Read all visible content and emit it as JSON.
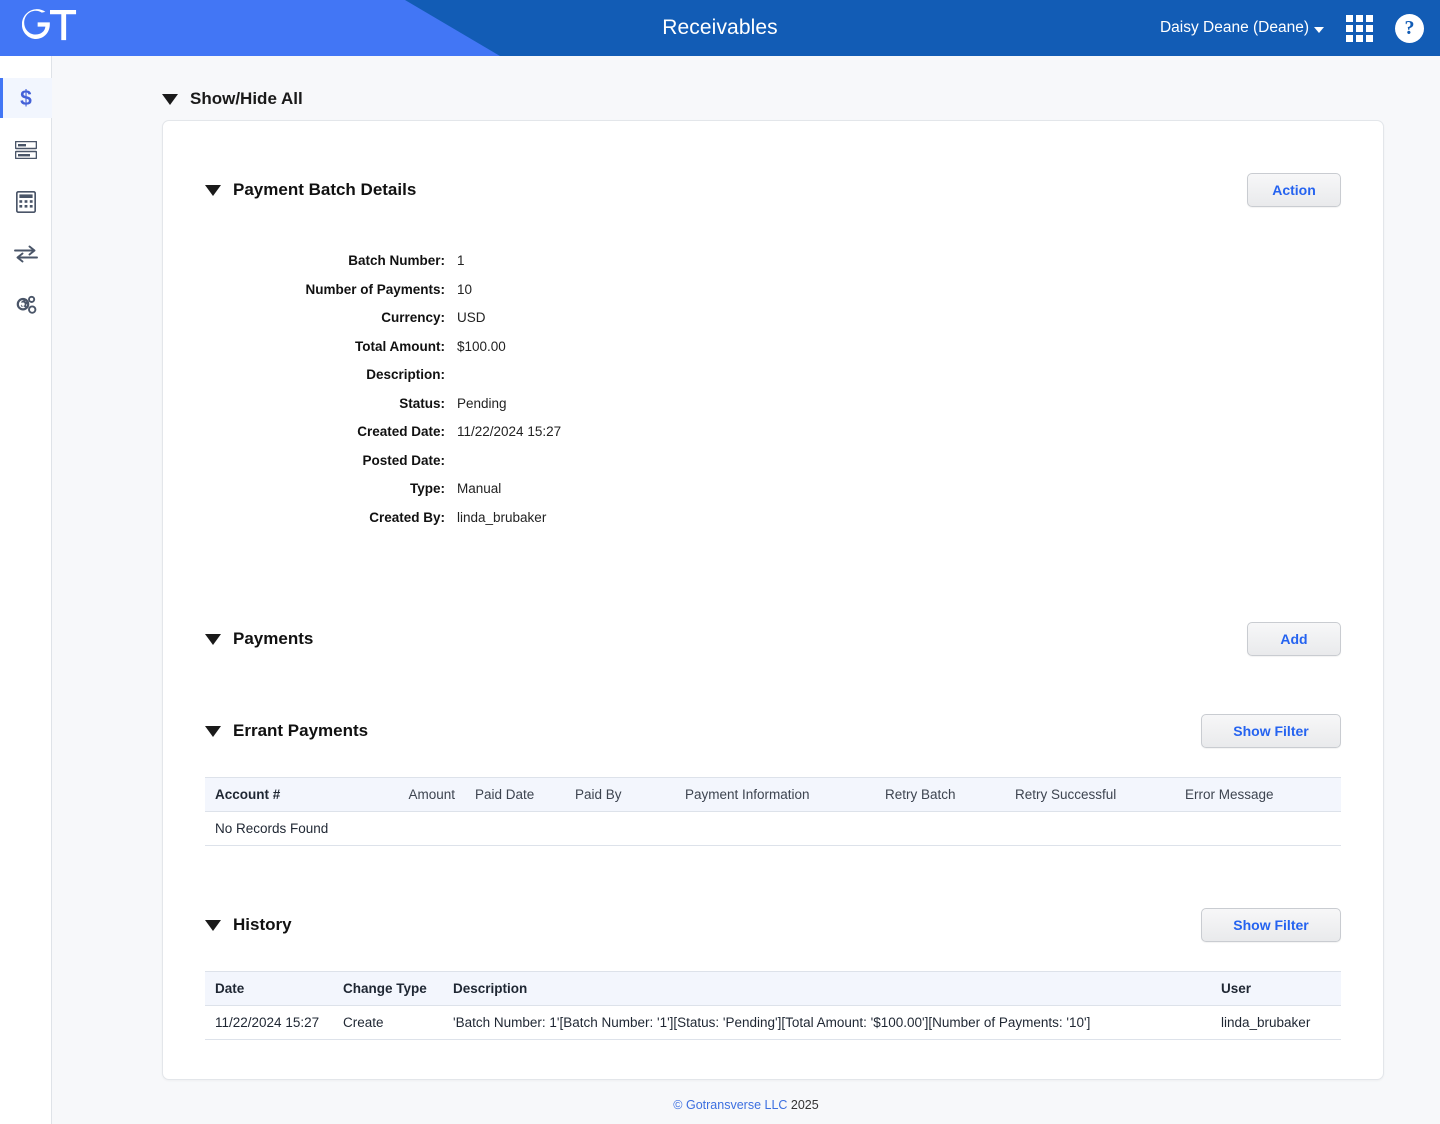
{
  "header": {
    "logo_text": "GT",
    "title": "Receivables",
    "user_menu": "Daisy Deane (Deane)",
    "apps_icon": "grid-apps-icon",
    "help_icon": "help-question-icon",
    "bg_left": "#4276f5",
    "bg_right": "#125cb5"
  },
  "sidebar": {
    "items": [
      {
        "icon": "dollar-sign-icon",
        "active": true
      },
      {
        "icon": "server-list-icon",
        "active": false
      },
      {
        "icon": "calculator-icon",
        "active": false
      },
      {
        "icon": "transfer-arrows-icon",
        "active": false
      },
      {
        "icon": "gears-settings-icon",
        "active": false
      }
    ]
  },
  "show_hide_all": {
    "label": "Show/Hide All"
  },
  "sections": {
    "payment_batch_details": {
      "title": "Payment Batch Details",
      "action_label": "Action",
      "fields": [
        {
          "label": "Batch Number:",
          "value": "1"
        },
        {
          "label": "Number of Payments:",
          "value": "10"
        },
        {
          "label": "Currency:",
          "value": "USD"
        },
        {
          "label": "Total Amount:",
          "value": "$100.00"
        },
        {
          "label": "Description:",
          "value": ""
        },
        {
          "label": "Status:",
          "value": "Pending"
        },
        {
          "label": "Created Date:",
          "value": "11/22/2024 15:27"
        },
        {
          "label": "Posted Date:",
          "value": ""
        },
        {
          "label": "Type:",
          "value": "Manual"
        },
        {
          "label": "Created By:",
          "value": "linda_brubaker"
        }
      ]
    },
    "payments": {
      "title": "Payments",
      "add_label": "Add"
    },
    "errant_payments": {
      "title": "Errant Payments",
      "show_filter_label": "Show Filter",
      "columns": [
        "Account #",
        "Amount",
        "Paid Date",
        "Paid By",
        "Payment Information",
        "Retry Batch",
        "Retry Successful",
        "Error Message"
      ],
      "empty_message": "No Records Found"
    },
    "history": {
      "title": "History",
      "show_filter_label": "Show Filter",
      "columns": [
        "Date",
        "Change Type",
        "Description",
        "User"
      ],
      "rows": [
        {
          "date": "11/22/2024 15:27",
          "change_type": "Create",
          "description": "'Batch Number: 1'[Batch Number: '1'][Status: 'Pending'][Total Amount: '$100.00'][Number of Payments: '10']",
          "user": "linda_brubaker"
        }
      ]
    }
  },
  "footer": {
    "copyright_symbol": "©",
    "company": "Gotransverse LLC",
    "year": "2025"
  }
}
